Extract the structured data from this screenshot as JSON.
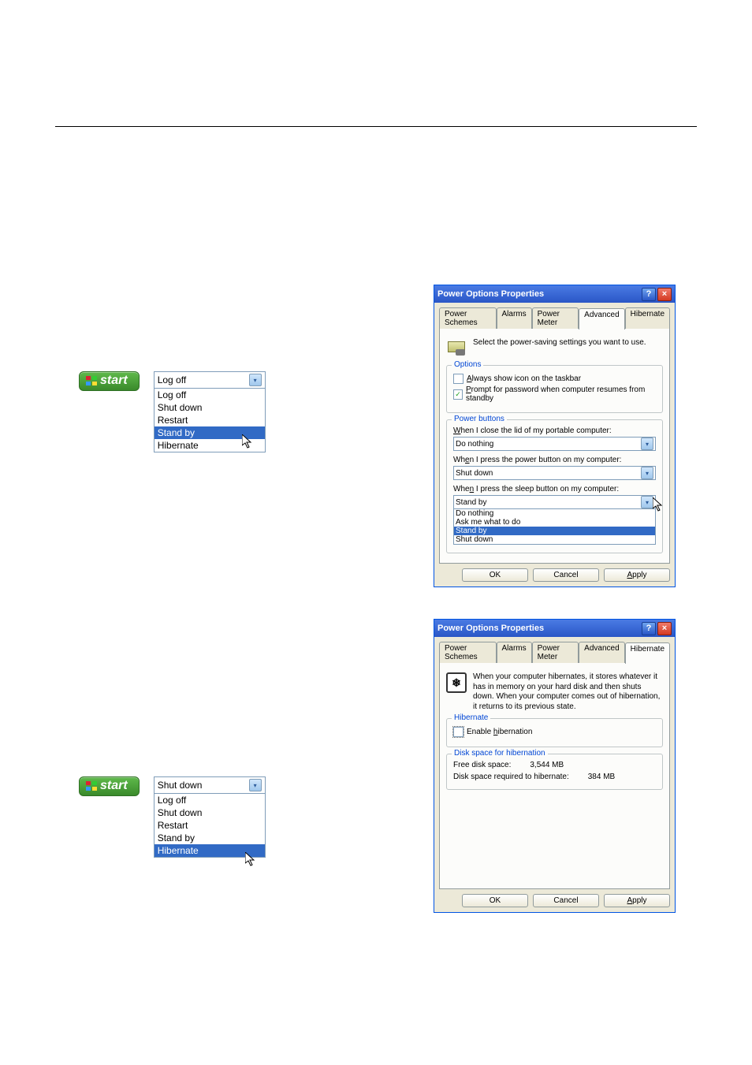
{
  "start_label": "start",
  "dropdown1": {
    "selected": "Log off",
    "items": [
      "Log off",
      "Shut down",
      "Restart",
      "Stand by",
      "Hibernate"
    ],
    "highlighted_index": 3
  },
  "dropdown2": {
    "selected": "Shut down",
    "items": [
      "Log off",
      "Shut down",
      "Restart",
      "Stand by",
      "Hibernate"
    ],
    "highlighted_index": 4
  },
  "dialog1": {
    "title": "Power Options Properties",
    "tabs": [
      "Power Schemes",
      "Alarms",
      "Power Meter",
      "Advanced",
      "Hibernate"
    ],
    "active_tab": 3,
    "description": "Select the power-saving settings you want to use.",
    "options_legend": "Options",
    "checkbox1": "Always show icon on the taskbar",
    "checkbox1_checked": false,
    "checkbox2": "Prompt for password when computer resumes from standby",
    "checkbox2_checked": true,
    "power_buttons_legend": "Power buttons",
    "lid_label": "When I close the lid of my portable computer:",
    "lid_value": "Do nothing",
    "power_label": "When I press the power button on my computer:",
    "power_value": "Shut down",
    "sleep_label": "When I press the sleep button on my computer:",
    "sleep_value": "Stand by",
    "sleep_options": [
      "Do nothing",
      "Ask me what to do",
      "Stand by",
      "Shut down"
    ],
    "sleep_highlighted_index": 2,
    "ok": "OK",
    "cancel": "Cancel",
    "apply": "Apply"
  },
  "dialog2": {
    "title": "Power Options Properties",
    "tabs": [
      "Power Schemes",
      "Alarms",
      "Power Meter",
      "Advanced",
      "Hibernate"
    ],
    "active_tab": 4,
    "description": "When your computer hibernates, it stores whatever it has in memory on your hard disk and then shuts down. When your computer comes out of hibernation, it returns to its previous state.",
    "hibernate_legend": "Hibernate",
    "enable_label": "Enable hibernation",
    "enable_checked": false,
    "disk_legend": "Disk space for hibernation",
    "free_label": "Free disk space:",
    "free_value": "3,544 MB",
    "req_label": "Disk space required to hibernate:",
    "req_value": "384 MB",
    "ok": "OK",
    "cancel": "Cancel",
    "apply": "Apply"
  }
}
